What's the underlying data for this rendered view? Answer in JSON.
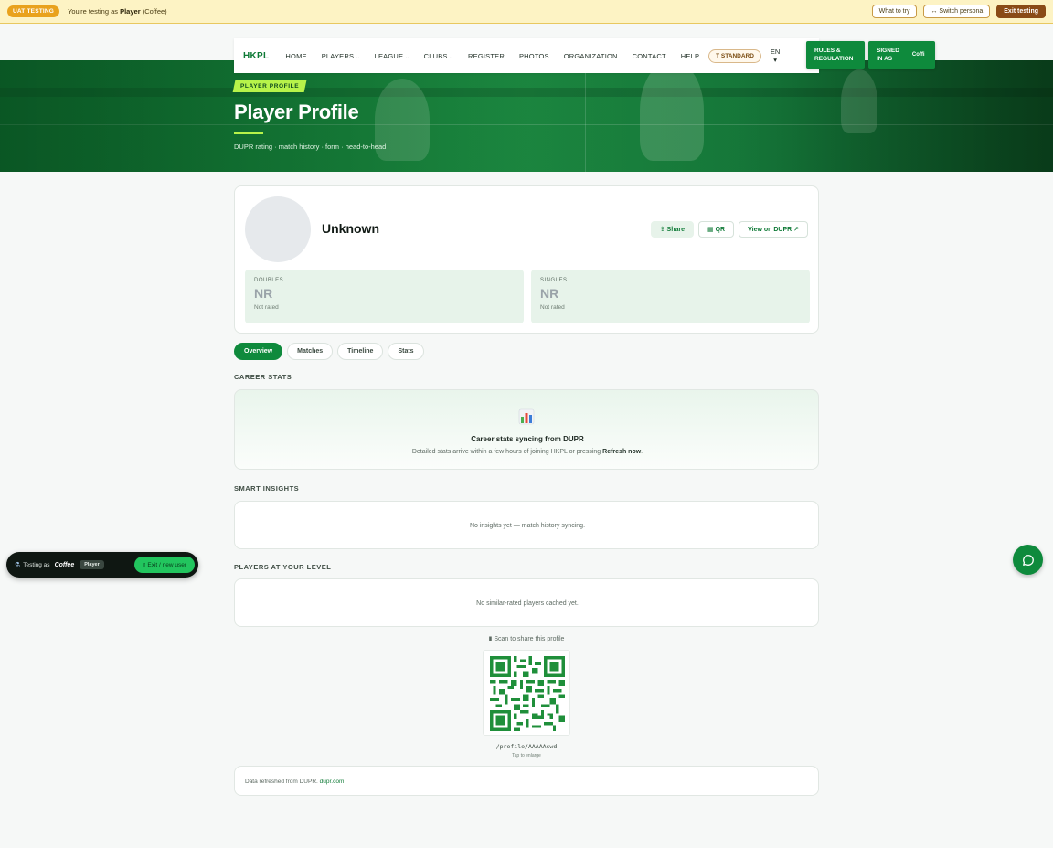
{
  "uat": {
    "badge": "UAT TESTING",
    "prefix": "You're testing as ",
    "persona": "Player",
    "persona_suffix": " (Coffee)",
    "what_to_try": "What to try",
    "switch_persona": "↔ Switch persona",
    "exit_testing": "Exit testing"
  },
  "nav": {
    "logo": "HKPL",
    "items": [
      {
        "label": "HOME",
        "caret": ""
      },
      {
        "label": "PLAYERS",
        "caret": "⌄"
      },
      {
        "label": "LEAGUE",
        "caret": "⌄"
      },
      {
        "label": "CLUBS",
        "caret": "⌄"
      },
      {
        "label": "REGISTER",
        "caret": ""
      },
      {
        "label": "PHOTOS",
        "caret": ""
      },
      {
        "label": "ORGANIZATION",
        "caret": ""
      },
      {
        "label": "CONTACT",
        "caret": ""
      },
      {
        "label": "HELP",
        "caret": ""
      }
    ],
    "standard_label": "T STANDARD",
    "lang": "EN",
    "lang_caret": "▾",
    "rules_line1": "RULES &",
    "rules_line2": "REGULATION",
    "signed_line1": "SIGNED",
    "signed_line2": "IN AS",
    "signed_name": "Coffi"
  },
  "hero": {
    "tag": "PLAYER PROFILE",
    "title": "Player Profile",
    "subtitle": "DUPR rating · match history · form · head-to-head"
  },
  "profile": {
    "name": "Unknown",
    "share": "Share",
    "qr": "QR",
    "view_dupr": "View on DUPR ↗",
    "doubles": {
      "label": "DOUBLES",
      "value": "NR",
      "note": "Not rated"
    },
    "singles": {
      "label": "SINGLES",
      "value": "NR",
      "note": "Not rated"
    }
  },
  "tabs": [
    "Overview",
    "Matches",
    "Timeline",
    "Stats"
  ],
  "career": {
    "section": "CAREER STATS",
    "icon": "bar-chart-icon",
    "title": "Career stats syncing from DUPR",
    "desc_prefix": "Detailed stats arrive within a few hours of joining HKPL or pressing ",
    "desc_bold": "Refresh now",
    "desc_suffix": "."
  },
  "insights": {
    "section": "SMART INSIGHTS",
    "empty": "No insights yet — match history syncing."
  },
  "level": {
    "section": "PLAYERS AT YOUR LEVEL",
    "empty": "No similar-rated players cached yet."
  },
  "qr": {
    "label": "Scan to share this profile",
    "path": "/profile/AAAAAswd",
    "tap": "Tap to enlarge"
  },
  "footer": {
    "text": "Data refreshed from DUPR. ",
    "link": "dupr.com"
  },
  "test_float": {
    "text": "Testing as",
    "name": "Coffee",
    "role": "Player",
    "exit": "Exit / new user"
  },
  "colors": {
    "brand_green": "#0e8a3c",
    "accent_lime": "#b7f34a",
    "uat_yellow": "#fdf3c4",
    "uat_badge": "#e9a21d"
  }
}
